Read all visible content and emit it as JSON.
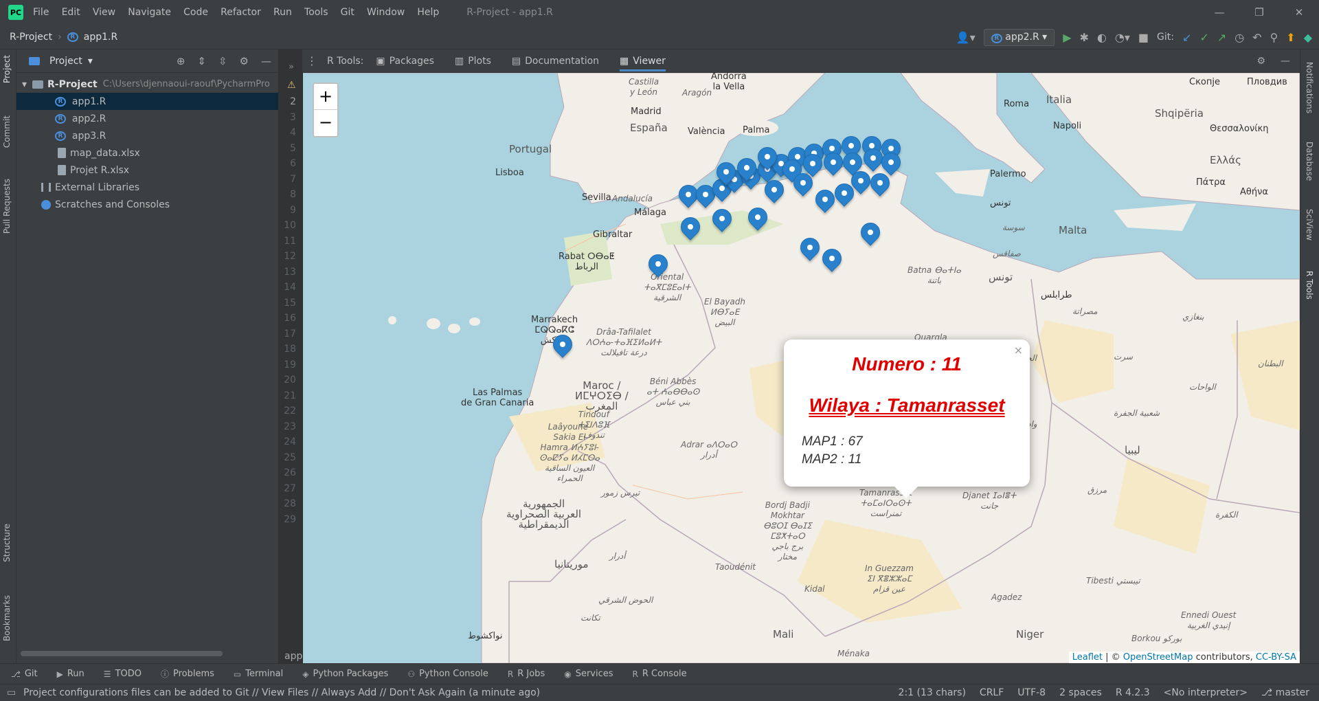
{
  "window": {
    "menu": [
      "File",
      "Edit",
      "View",
      "Navigate",
      "Code",
      "Refactor",
      "Run",
      "Tools",
      "Git",
      "Window",
      "Help"
    ],
    "title": "R-Project - app1.R"
  },
  "navbar": {
    "project": "R-Project",
    "file": "app1.R",
    "run_config": "app2.R",
    "git_label": "Git:"
  },
  "project_panel": {
    "header": "Project",
    "root_name": "R-Project",
    "root_path": "C:\\Users\\djennaoui-raouf\\PycharmPro",
    "files": [
      "app1.R",
      "app2.R",
      "app3.R",
      "map_data.xlsx",
      "Projet R.xlsx"
    ],
    "external_libraries": "External Libraries",
    "scratches": "Scratches and Consoles"
  },
  "left_stripe": {
    "project": "Project",
    "commit": "Commit",
    "pull_requests": "Pull Requests",
    "structure": "Structure",
    "bookmarks": "Bookmarks"
  },
  "right_stripe": {
    "notifications": "Notifications",
    "database": "Database",
    "sciview": "SciView",
    "rtools": "R Tools"
  },
  "gutter": {
    "lines": [
      "2",
      "3",
      "4",
      "5",
      "6",
      "7",
      "8",
      "9",
      "10",
      "11",
      "12",
      "13",
      "14",
      "15",
      "16",
      "17",
      "18",
      "19",
      "20",
      "21",
      "22",
      "23",
      "24",
      "25",
      "26",
      "27",
      "28",
      "29"
    ],
    "bottom_text": "app"
  },
  "rtools": {
    "label": "R Tools:",
    "tabs": [
      "Packages",
      "Plots",
      "Documentation",
      "Viewer"
    ],
    "active_tab": "Viewer"
  },
  "map": {
    "zoom_in": "+",
    "zoom_out": "−",
    "popup": {
      "numero": "Numero : 11",
      "wilaya": "Wilaya : Tamanrasset",
      "map1": "MAP1 : 67",
      "map2": "MAP2 : 11",
      "close": "×"
    },
    "attribution": {
      "leaflet": "Leaflet",
      "sep": " | © ",
      "osm": "OpenStreetMap",
      "contrib": " contributors, ",
      "license": "CC-BY-SA"
    },
    "labels": {
      "andorra": "Andorra\nla Vella",
      "castilla": "Castilla\ny León",
      "aragon": "Aragón",
      "madrid": "Madrid",
      "espana": "España",
      "valencia": "València",
      "palma": "Palma",
      "portugal": "Portugal",
      "lisboa": "Lisboa",
      "sevilla": "Sevilla",
      "andalucia": "Andalucía",
      "malaga": "Málaga",
      "gibraltar": "Gibraltar",
      "rabat": "Rabat ⵔⴱⴰⵟ\nالرباط",
      "marrakech": "Marrakech\nⵎⵕⵕⴰⴽⵛ\nمراكش",
      "draa": "Drâa-Tafilalet\nⴷⵔⵄⴰ-ⵜⴰⴼⵉⵍⴰⵍⵜ\nدرعة تافيلالت",
      "oriental": "Oriental\nⵜⴰⴳⵎⵓⴹⴰⵏⵜ\nالشرقية",
      "elbayadh": "El Bayadh\nⵍⴱⵢⴰⴹ\nالبيض",
      "beniabbes": "Béni Abbès\nⴰⵜ ⵄⴰⴱⴱⴰⵙ\nبني عباس",
      "maroc": "Maroc /\nⵍⵎⵖⵔⵉⴱ /\nالمغرب",
      "laspalmas": "Las Palmas\nde Gran Canaria",
      "tindouf": "Tindouf\nⵜⵉⵏⴷⵓⴼ\nتندوف",
      "laayoune": "Laâyoune-\nSakia El\nHamra ⵍⵄⵢⵓⵏ-\nⵙⴰⵇⵢⴰ ⵍⵃⵎⵔⴰ\nالعيون الساقية\nالحمراء",
      "adrar": "Adrar ⴰⴷⵔⴰⵔ\nأدرار",
      "zemmour": "تيرس زمور",
      "rasd": "الجمهورية\nالعربية الصحراوية\nالديمقراطية",
      "bordj": "Bordj Badji\nMokhtar\nⴱⵓⵔⵊ ⴱⴰⵊⵉ\nⵎⵓⵅⵜⴰⵔ\nبرج باجي\nمختار",
      "tamanrasset": "Tamanrasset\nⵜⴰⵎⴰⵏⵔⴰⵙⵜ\nتمنراست",
      "djanet": "Djanet ⵊⴰⵏⴻⵜ\nجانت",
      "inguezzam": "In Guezzam\nⵉⵏ ⴳⴻⵣⵣⴰⵎ\nعين قزام",
      "mauritanie": "موريتانيا",
      "adrar2": "أدرار",
      "taoudeni": "Taoudénit",
      "kidal": "Kidal",
      "hodh": "الحوض الشرقي",
      "tagant": "تكانت",
      "nouakchott": "نواكشوط",
      "mali": "Mali",
      "menaka": "Ménaka",
      "agadez": "Agadez",
      "niger": "Niger",
      "tibesti": "Tibesti تيبستي",
      "ennedi": "Ennedi Ouest\nإنيدي الغربية",
      "borkou": "Borkou بوركو",
      "murzuq": "مرزق",
      "kufra": "الكفرة",
      "libya": "ليبيا",
      "wahat": "الواحات",
      "jufra": "شعبية الجفرة",
      "batna": "Batna ⴱⴰⵜⵏⴰ\nباتنة",
      "ouargla": "Ouargla",
      "jabal": "الجبل الغربي",
      "shati": "وادي الشاطئ",
      "butnan": "البطنان",
      "sirte": "سرت",
      "misrata": "مصراتة",
      "benghazi": "بنغازي",
      "tarabulus": "طرابلس",
      "tounes": "تونس",
      "tunis": "تونس",
      "sousse": "سوسة",
      "sfax": "صفاقس",
      "malta": "Malta",
      "palermo": "Palermo",
      "roma": "Roma",
      "italia": "Italia",
      "napoli": "Napoli",
      "shqiperia": "Shqipëria",
      "skopje": "Скопје",
      "plovdiv": "Пловдив",
      "thessaloniki": "Θεσσαλονίκη",
      "ellas": "Ελλάς",
      "patra": "Πάτρα",
      "athina": "Αθήνα"
    }
  },
  "bottom_tabs": [
    "Git",
    "Run",
    "TODO",
    "Problems",
    "Terminal",
    "Python Packages",
    "Python Console",
    "R Jobs",
    "Services",
    "R Console"
  ],
  "status": {
    "message": "Project configurations files can be added to Git // View Files // Always Add // Don't Ask Again (a minute ago)",
    "position": "2:1 (13 chars)",
    "line_sep": "CRLF",
    "encoding": "UTF-8",
    "indent": "2 spaces",
    "r_version": "R 4.2.3",
    "interpreter": "<No interpreter>",
    "branch": "master"
  }
}
